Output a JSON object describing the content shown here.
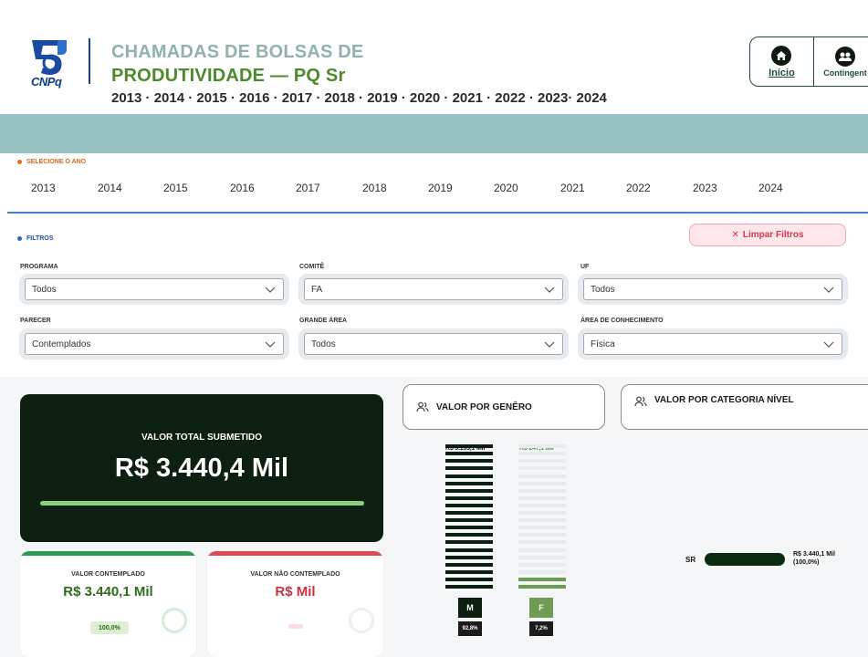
{
  "header": {
    "logo_text": "CNPq",
    "title_line1": "CHAMADAS DE BOLSAS DE",
    "title_line2": "PRODUTIVIDADE — PQ Sr",
    "years_line": "2013 · 2014 · 2015 · 2016 · 2017 · 2018 · 2019 · 2020 · 2021 · 2022 · 2023· 2024"
  },
  "nav": {
    "home_label": "Início",
    "contingent_label": "Contingent"
  },
  "year_selector": {
    "label": "SELECIONE O ANO",
    "years": [
      "2013",
      "2014",
      "2015",
      "2016",
      "2017",
      "2018",
      "2019",
      "2020",
      "2021",
      "2022",
      "2023",
      "2024"
    ]
  },
  "filters": {
    "label": "FILTROS",
    "clear_label": "Limpar Filtros",
    "programa": {
      "label": "PROGRAMA",
      "value": "Todos"
    },
    "comite": {
      "label": "COMITÊ",
      "value": "FA"
    },
    "uf": {
      "label": "UF",
      "value": "Todos"
    },
    "parecer": {
      "label": "PARECER",
      "value": "Contemplados"
    },
    "grande_area": {
      "label": "GRANDE ÁREA",
      "value": "Todos"
    },
    "area_conhecimento": {
      "label": "ÁREA DE CONHECIMENTO",
      "value": "Física"
    }
  },
  "totals": {
    "submitted_title": "VALOR TOTAL SUBMETIDO",
    "submitted_value": "R$ 3.440,4 Mil",
    "contemplated_title": "VALOR CONTEMPLADO",
    "contemplated_value": "R$ 3.440,1 Mil",
    "contemplated_pct": "100,0%",
    "not_contemplated_title": "VALOR NÃO CONTEMPLADO",
    "not_contemplated_value": "R$ Mil"
  },
  "panels": {
    "gender_title": "VALOR POR GENÊRO",
    "category_title": "VALOR POR CATEGORIA NÍVEL"
  },
  "colors": {
    "dark_green": "#0c1f10",
    "light_green": "#8ad07a",
    "mid_green": "#6e9c55",
    "red": "#e0484f",
    "teal": "#98c2c1"
  },
  "chart_data": [
    {
      "type": "bar",
      "categories": [
        "M",
        "F"
      ],
      "series": [
        {
          "values": [
            3193.1,
            247.1
          ]
        }
      ],
      "value_labels": [
        "R$ 3.193,1 Mil",
        "R$ 247,1 Mil"
      ],
      "percent_labels": [
        "92,8%",
        "7,2%"
      ],
      "percents": [
        92.8,
        7.2
      ]
    },
    {
      "type": "bar",
      "categories": [
        "SR"
      ],
      "series": [
        {
          "values": [
            3440.1
          ]
        }
      ],
      "value_labels": [
        "R$ 3.440,1 Mil",
        "(100,0%)"
      ]
    }
  ]
}
